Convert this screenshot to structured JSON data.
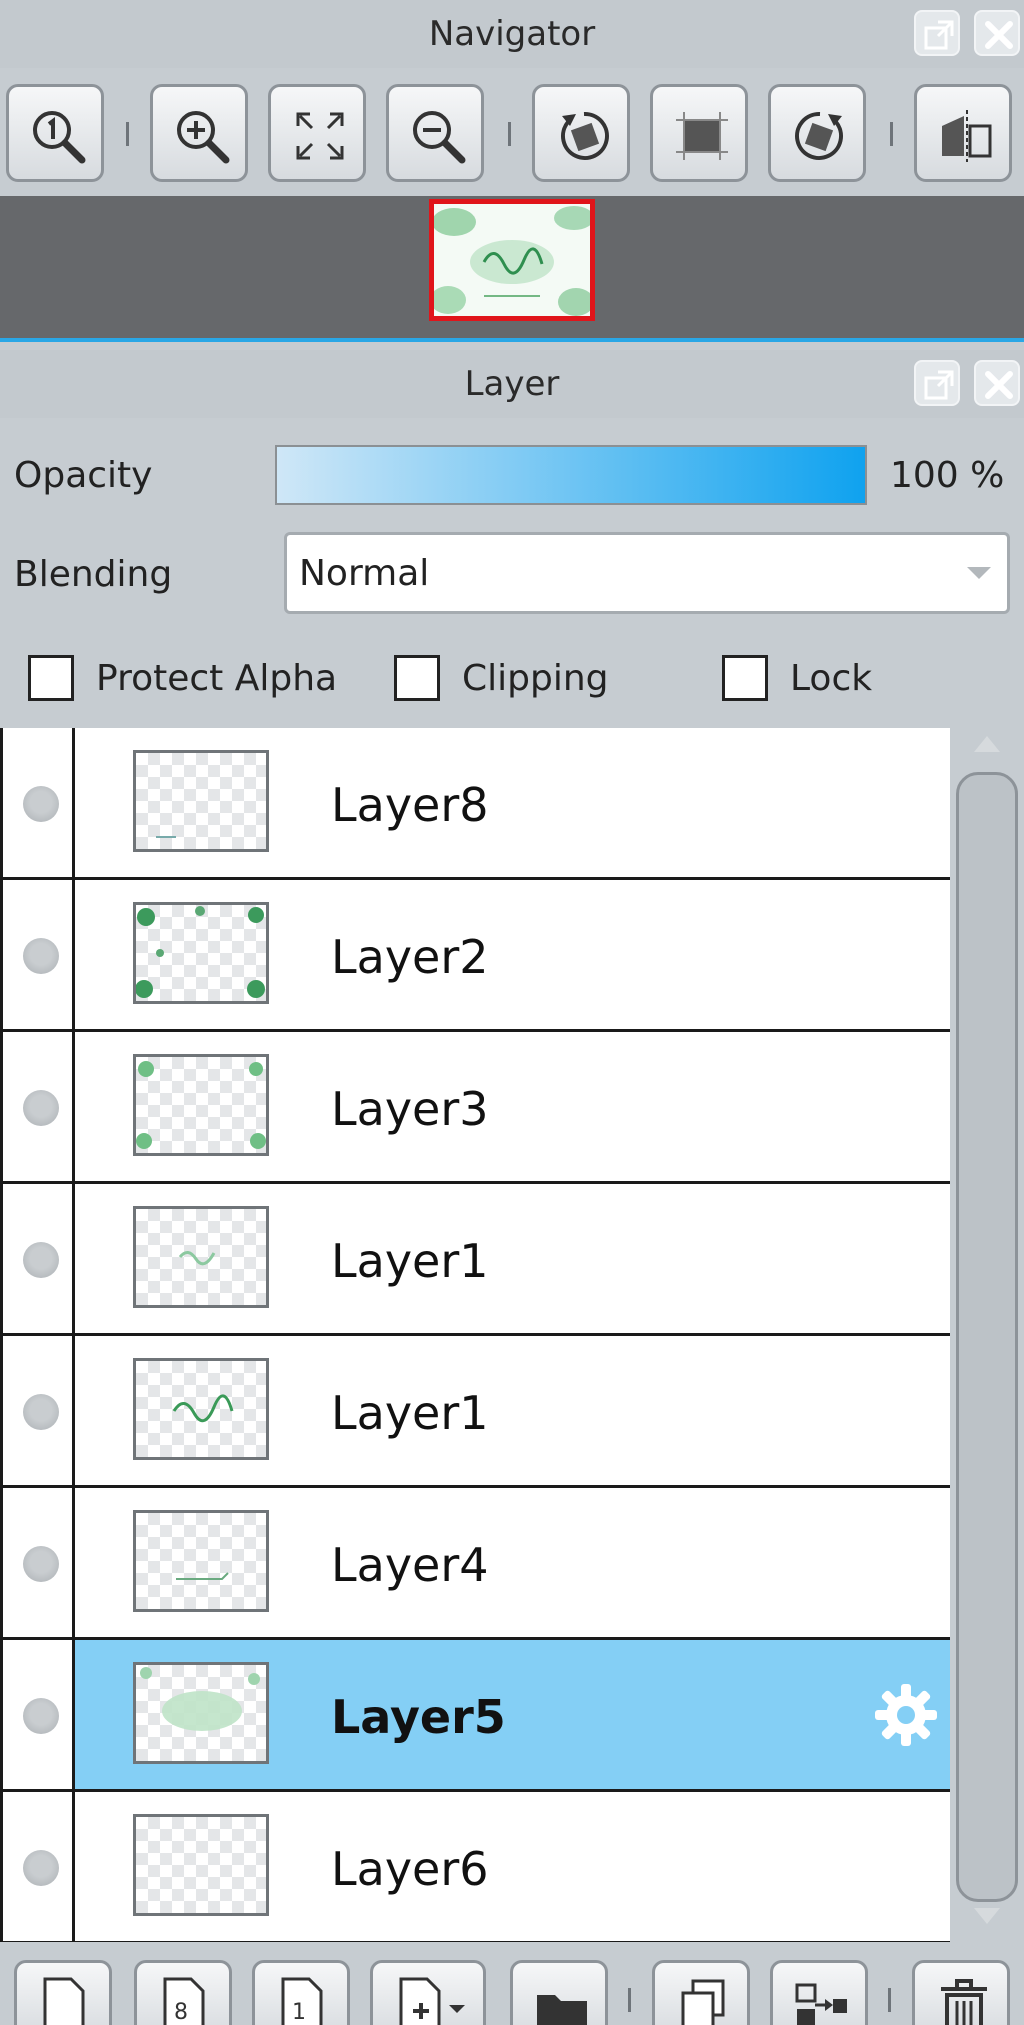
{
  "navigator": {
    "title": "Navigator",
    "toolbar": [
      "zoom-actual-size",
      "zoom-in",
      "fit-window",
      "zoom-out",
      "rotate-left",
      "reset-rotation",
      "rotate-right",
      "flip-horizontal"
    ]
  },
  "layer_panel": {
    "title": "Layer",
    "opacity_label": "Opacity",
    "opacity_value": "100 %",
    "opacity_fraction": 1.0,
    "blending_label": "Blending",
    "blending_value": "Normal",
    "checkboxes": {
      "protect_alpha": {
        "label": "Protect Alpha",
        "checked": false
      },
      "clipping": {
        "label": "Clipping",
        "checked": false
      },
      "lock": {
        "label": "Lock",
        "checked": false
      }
    },
    "layers": [
      {
        "name": "Layer8"
      },
      {
        "name": "Layer2"
      },
      {
        "name": "Layer3"
      },
      {
        "name": "Layer1"
      },
      {
        "name": "Layer1"
      },
      {
        "name": "Layer4"
      },
      {
        "name": "Layer5",
        "selected": true
      },
      {
        "name": "Layer6"
      }
    ]
  },
  "colors": {
    "accent": "#0fa2ef",
    "selection": "#84cff5",
    "navigator_frame": "#e0141a"
  }
}
